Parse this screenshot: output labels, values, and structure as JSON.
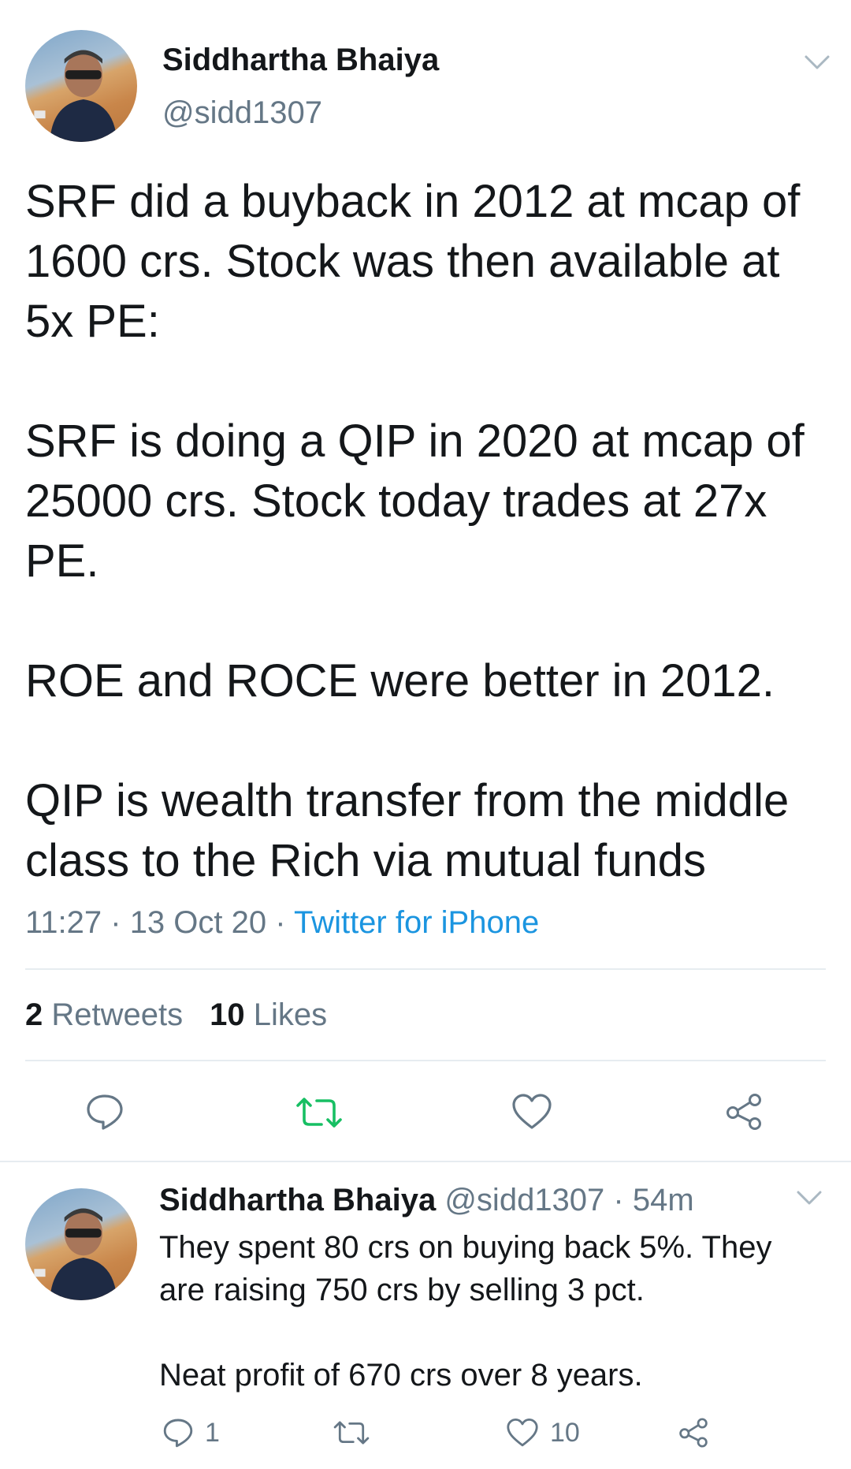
{
  "tweet": {
    "author_name": "Siddhartha Bhaiya",
    "author_handle": "@sidd1307",
    "paragraphs": [
      "SRF did a buyback in 2012 at mcap of 1600 crs. Stock was then available at 5x PE:",
      "SRF is doing a QIP in 2020 at mcap of 25000 crs. Stock today trades at 27x PE.",
      "ROE and ROCE were better in 2012.",
      "QIP is wealth transfer from the middle class to the Rich via mutual funds"
    ],
    "time": "11:27",
    "date": "13 Oct 20",
    "source": "Twitter for iPhone",
    "separator": " · ",
    "retweets_count": "2",
    "retweets_label": "Retweets",
    "likes_count": "10",
    "likes_label": "Likes",
    "icons": [
      "reply-icon",
      "retweet-icon",
      "like-icon",
      "share-icon",
      "chevron-down-icon"
    ],
    "retweet_active_color": "#17bf63"
  },
  "reply": {
    "author_name": "Siddhartha Bhaiya",
    "author_handle": "@sidd1307",
    "age": "· 54m",
    "paragraphs": [
      "They spent 80 crs on buying back 5%. They are raising 750 crs by selling 3 pct.",
      "Neat profit of 670 crs over 8 years."
    ],
    "reply_count": "1",
    "like_count": "10"
  },
  "colors": {
    "text": "#14171a",
    "secondary": "#657786",
    "link": "#1b95e0",
    "divider": "#e6ecf0"
  }
}
